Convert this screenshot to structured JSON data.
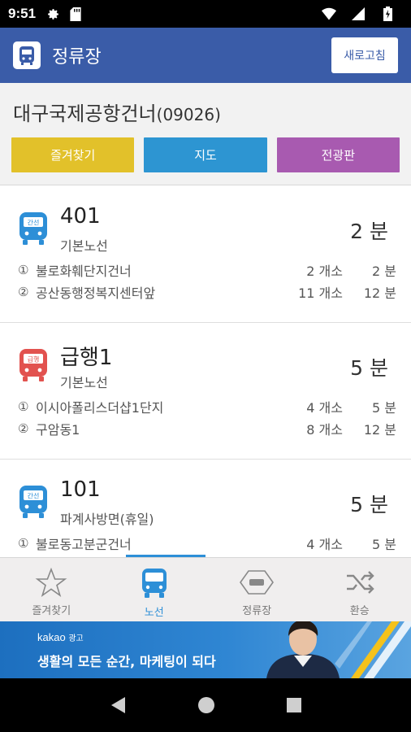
{
  "status": {
    "time": "9:51"
  },
  "appbar": {
    "title": "정류장",
    "refresh_label": "새로고침"
  },
  "stop": {
    "name": "대구국제공항건너",
    "code": "(09026)",
    "buttons": [
      {
        "label": "즐겨찾기",
        "color": "#e2c12a"
      },
      {
        "label": "지도",
        "color": "#2d95d2"
      },
      {
        "label": "전광판",
        "color": "#a85ab0"
      }
    ]
  },
  "routes": [
    {
      "number": "401",
      "type": "기본노선",
      "eta": "2 분",
      "bus_color": "#2d8fd7",
      "bus_tag": "간선",
      "stops": [
        {
          "idx": "①",
          "name": "불로화훼단지건너",
          "count": "2 개소",
          "min": "2 분"
        },
        {
          "idx": "②",
          "name": "공산동행정복지센터앞",
          "count": "11 개소",
          "min": "12 분"
        }
      ]
    },
    {
      "number": "급행1",
      "type": "기본노선",
      "eta": "5 분",
      "bus_color": "#e2524f",
      "bus_tag": "급행",
      "stops": [
        {
          "idx": "①",
          "name": "이시아폴리스더샵1단지",
          "count": "4 개소",
          "min": "5 분"
        },
        {
          "idx": "②",
          "name": "구암동1",
          "count": "8 개소",
          "min": "12 분"
        }
      ]
    },
    {
      "number": "101",
      "type": "파계사방면(휴일)",
      "eta": "5 분",
      "bus_color": "#2d8fd7",
      "bus_tag": "간선",
      "stops": [
        {
          "idx": "①",
          "name": "불로동고분군건너",
          "count": "4 개소",
          "min": "5 분"
        }
      ]
    }
  ],
  "tabs": [
    {
      "label": "즐겨찾기",
      "icon": "star-icon",
      "active": false
    },
    {
      "label": "노선",
      "icon": "bus-icon",
      "active": true
    },
    {
      "label": "정류장",
      "icon": "bus-stop-sign-icon",
      "active": false
    },
    {
      "label": "환승",
      "icon": "shuffle-icon",
      "active": false
    }
  ],
  "ad": {
    "brand": "kakao",
    "brand_tag": "광고",
    "copy": "생활의 모든 순간, 마케팅이 되다"
  },
  "colors": {
    "appbar": "#3a5ca8",
    "accent": "#2d8fd7"
  }
}
